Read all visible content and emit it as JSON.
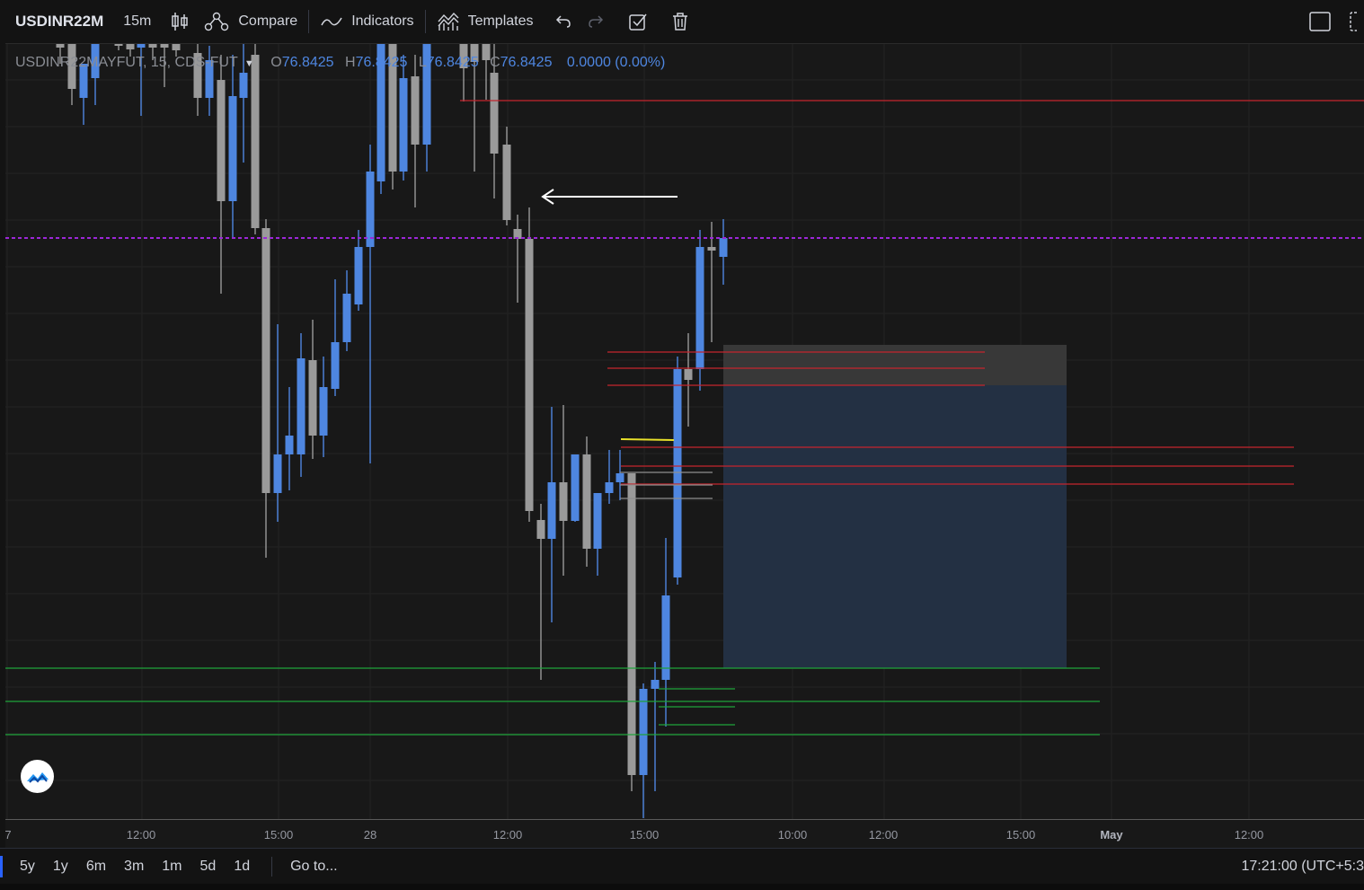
{
  "toolbar": {
    "symbol": "USDINR22M",
    "interval": "15m",
    "compare_label": "Compare",
    "indicators_label": "Indicators",
    "templates_label": "Templates"
  },
  "legend": {
    "symbol_full": "USDINR22MAYFUT, 15, CDS-FUT",
    "o_key": "O",
    "o": "76.8425",
    "h_key": "H",
    "h": "76.8425",
    "l_key": "L",
    "l": "76.8425",
    "c_key": "C",
    "c": "76.8425",
    "change": "0.0000 (0.00%)"
  },
  "colors": {
    "background": "#181818",
    "up_candle": "#4e86e0",
    "down_candle": "#9a9a9a",
    "red_level": "#c4242d",
    "green_level": "#1fa33a",
    "purple_level": "#9c27d8",
    "yellow_level": "#e8e02a",
    "white_level": "#8f8f8f",
    "zone_gray": "#3a3a3a",
    "zone_blue": "#243246"
  },
  "time_axis": {
    "ticks": [
      "7",
      "12:00",
      "15:00",
      "28",
      "12:00",
      "15:00",
      "10:00",
      "12:00",
      "15:00",
      "May",
      "12:00"
    ]
  },
  "bottom_bar": {
    "ranges": [
      "5y",
      "1y",
      "6m",
      "3m",
      "1m",
      "5d",
      "1d"
    ],
    "goto_label": "Go to...",
    "clock": "17:21:00 (UTC+5:3"
  },
  "chart_data": {
    "type": "candlestick",
    "price_scale": "hidden",
    "x": [
      "7",
      "12:00",
      "15:00",
      "28",
      "12:00",
      "15:00",
      "10:00",
      "12:00",
      "15:00",
      "May",
      "12:00"
    ],
    "close_last": 76.8425,
    "markers": [
      {
        "kind": "arrow",
        "direction": "left"
      }
    ]
  }
}
